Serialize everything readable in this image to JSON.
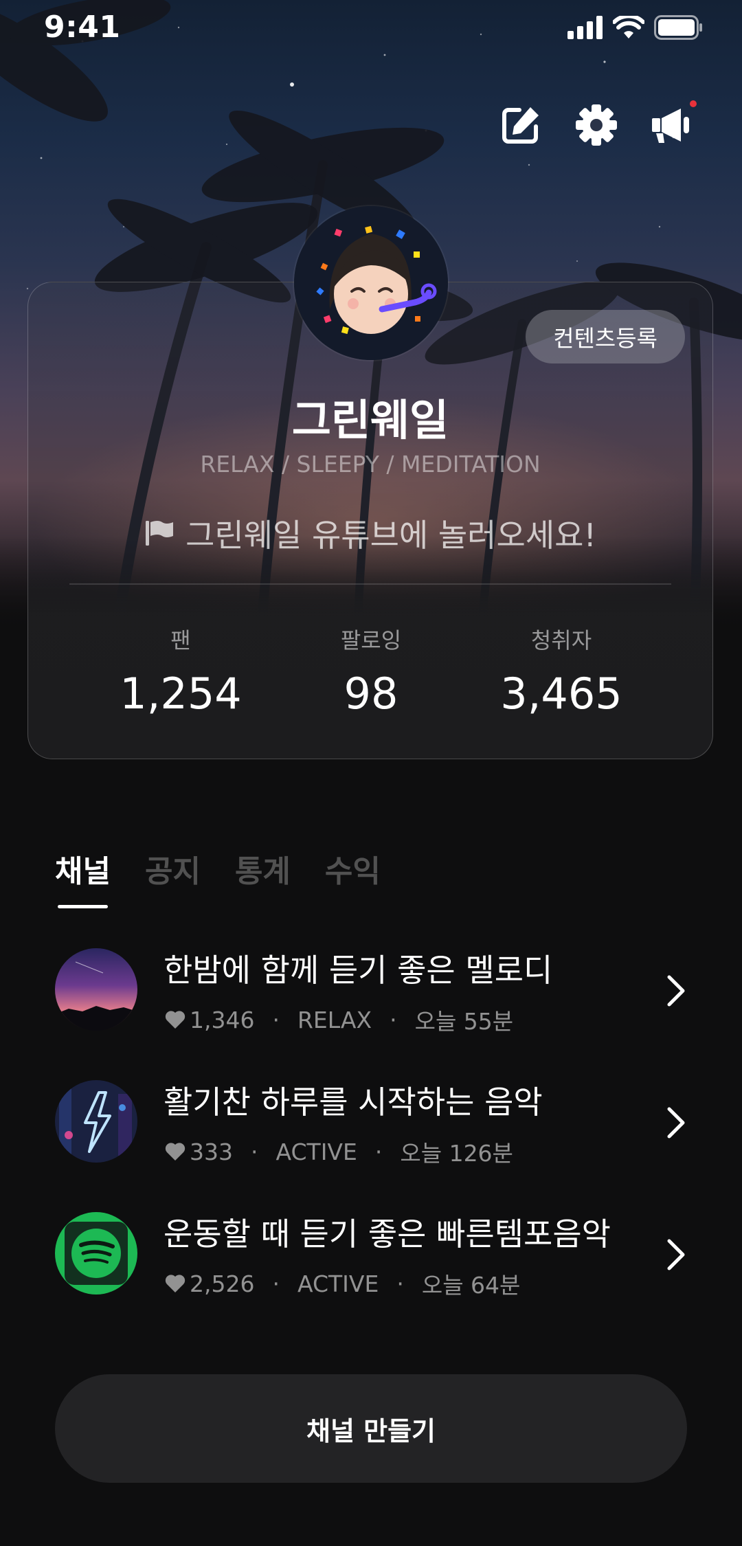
{
  "status_bar": {
    "time": "9:41"
  },
  "profile": {
    "name": "그린웨일",
    "tags": "RELAX / SLEEPY / MEDITATION",
    "notice": "그린웨일 유튜브에 놀러오세요!",
    "register_label": "컨텐츠등록"
  },
  "stats": [
    {
      "label": "팬",
      "value": "1,254"
    },
    {
      "label": "팔로잉",
      "value": "98"
    },
    {
      "label": "청취자",
      "value": "3,465"
    }
  ],
  "tabs": [
    {
      "label": "채널",
      "active": true
    },
    {
      "label": "공지",
      "active": false
    },
    {
      "label": "통계",
      "active": false
    },
    {
      "label": "수익",
      "active": false
    }
  ],
  "channels": [
    {
      "title": "한밤에 함께 듣기 좋은 멜로디",
      "likes": "1,346",
      "category": "RELAX",
      "time": "오늘 55분"
    },
    {
      "title": "활기찬 하루를 시작하는 음악",
      "likes": "333",
      "category": "ACTIVE",
      "time": "오늘 126분"
    },
    {
      "title": "운동할 때 듣기 좋은 빠른템포음악",
      "likes": "2,526",
      "category": "ACTIVE",
      "time": "오늘 64분"
    }
  ],
  "meta_separator": "·",
  "create_button": {
    "label": "채널 만들기"
  },
  "colors": {
    "background": "#0e0e0f",
    "notification_dot": "#e8323b",
    "spotify_green": "#1db954"
  },
  "icons": [
    "edit-icon",
    "gear-icon",
    "megaphone-icon",
    "flag-icon",
    "heart-icon",
    "chevron-right-icon"
  ]
}
